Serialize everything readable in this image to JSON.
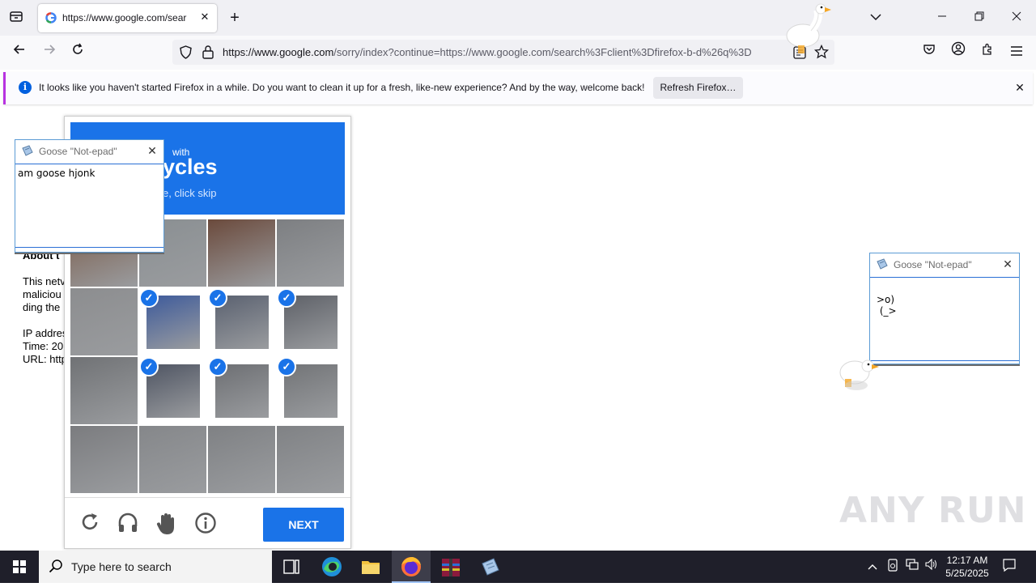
{
  "browser": {
    "tab_title": "https://www.google.com/sear",
    "url_domain": "https://www.google.com",
    "url_rest": "/sorry/index?continue=https://www.google.com/search%3Fclient%3Dfirefox-b-d%26q%3D"
  },
  "notification": {
    "message": "It looks like you haven't started Firefox in a while. Do you want to clean it up for a fresh, like-new experience? And by the way, welcome back!",
    "button": "Refresh Firefox…"
  },
  "page": {
    "about": "About t",
    "lines": [
      "This netv",
      "maliciou",
      "ding the"
    ],
    "ip": "IP addres",
    "time": "Time: 20",
    "url": "URL: http"
  },
  "captcha": {
    "header_line1": "with",
    "header_line2": "ycles",
    "header_line3": "e, click skip",
    "next_label": "NEXT",
    "tiles": [
      {
        "selected": false,
        "color": "#7a5b49"
      },
      {
        "selected": false,
        "color": "#8a8f92"
      },
      {
        "selected": false,
        "color": "#6b4a3c"
      },
      {
        "selected": false,
        "color": "#7d7f82"
      },
      {
        "selected": false,
        "color": "#8c8d8f"
      },
      {
        "selected": true,
        "color": "#3d5a9b"
      },
      {
        "selected": true,
        "color": "#5a6170"
      },
      {
        "selected": true,
        "color": "#5e6168"
      },
      {
        "selected": false,
        "color": "#707275"
      },
      {
        "selected": true,
        "color": "#4f5563"
      },
      {
        "selected": true,
        "color": "#6d6f73"
      },
      {
        "selected": true,
        "color": "#727477"
      },
      {
        "selected": false,
        "color": "#7b7c7f"
      },
      {
        "selected": false,
        "color": "#85878a"
      },
      {
        "selected": false,
        "color": "#7f8184"
      },
      {
        "selected": false,
        "color": "#808285"
      }
    ]
  },
  "notepad_left": {
    "title": "Goose \"Not-epad\"",
    "text": "am goose hjonk"
  },
  "notepad_right": {
    "title": "Goose \"Not-epad\"",
    "text": ">o)\n (_>"
  },
  "taskbar": {
    "search_placeholder": "Type here to search",
    "time": "12:17 AM",
    "date": "5/25/2025"
  },
  "watermark": "ANY RUN"
}
